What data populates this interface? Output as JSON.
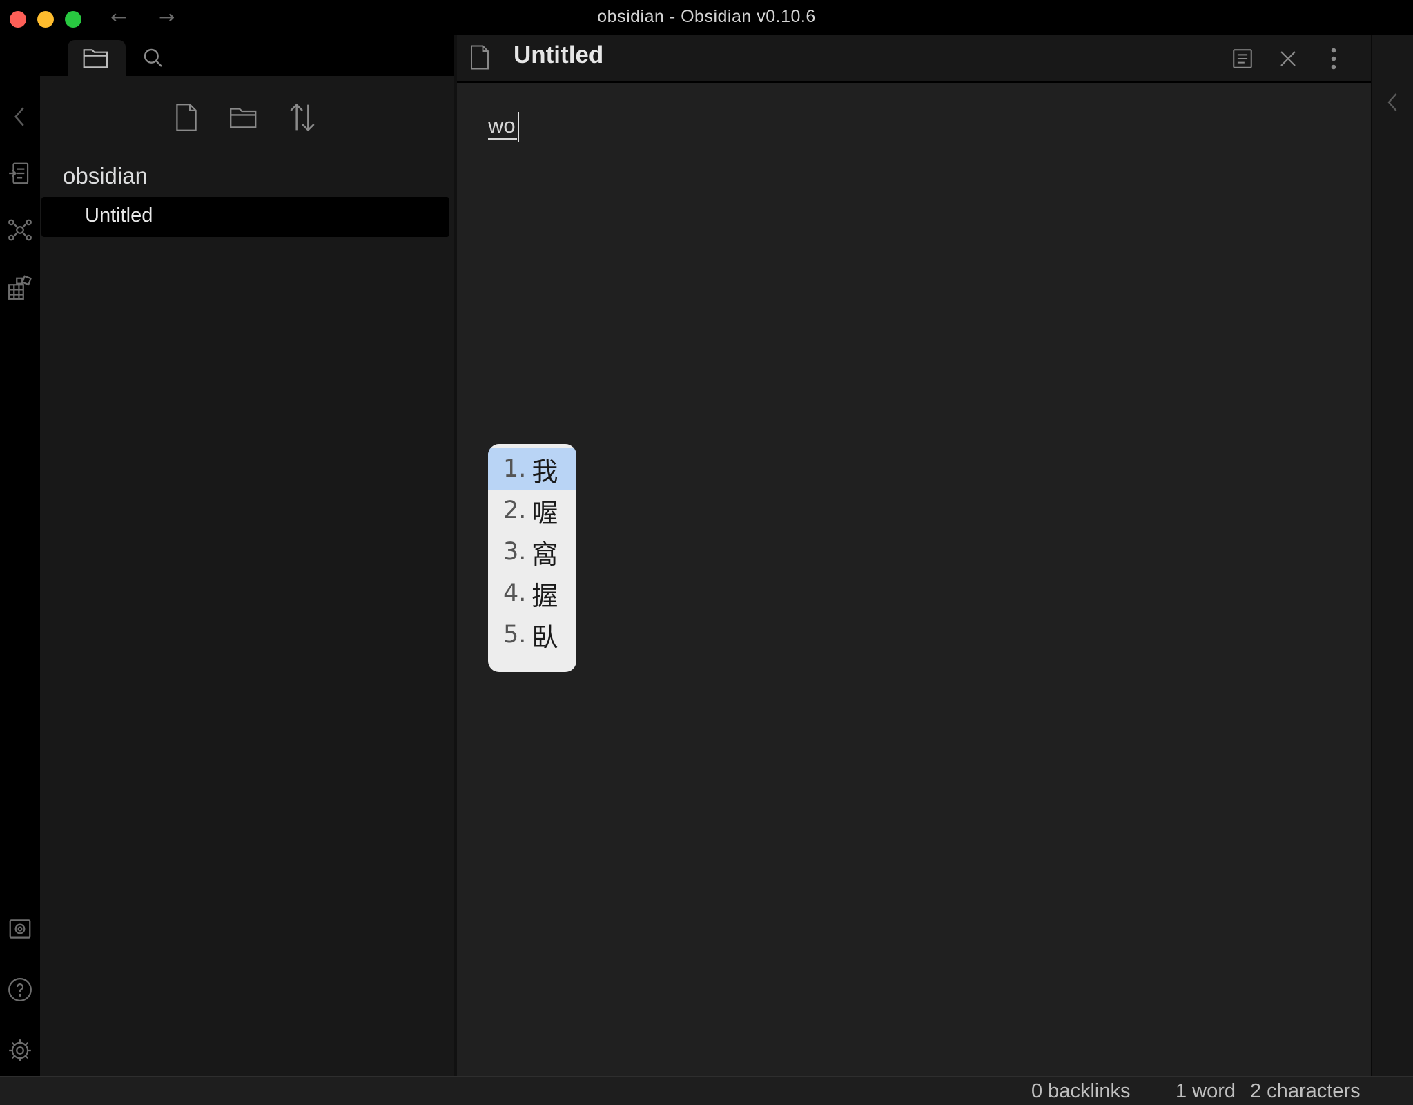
{
  "window": {
    "title": "obsidian - Obsidian v0.10.6",
    "back_arrow": "←",
    "forward_arrow": "→"
  },
  "ribbon": {
    "icons": [
      "collapse-left-icon",
      "open-quick-switcher-icon",
      "graph-view-icon",
      "templates-icon",
      "vault-switch-icon",
      "help-icon",
      "settings-icon"
    ]
  },
  "sidebar": {
    "tabs": [
      "file-explorer-tab",
      "search-tab"
    ],
    "tools": [
      "new-note-icon",
      "new-folder-icon",
      "sort-icon"
    ],
    "vault_name": "obsidian",
    "files": [
      {
        "name": "Untitled",
        "active": true
      }
    ]
  },
  "editor": {
    "title": "Untitled",
    "text": "wo",
    "header_actions": [
      "preview-toggle-icon",
      "close-icon",
      "more-options-icon"
    ]
  },
  "ime_candidates": [
    {
      "num": "1.",
      "char": "我",
      "selected": true
    },
    {
      "num": "2.",
      "char": "喔",
      "selected": false
    },
    {
      "num": "3.",
      "char": "窩",
      "selected": false
    },
    {
      "num": "4.",
      "char": "握",
      "selected": false
    },
    {
      "num": "5.",
      "char": "臥",
      "selected": false
    }
  ],
  "status_bar": {
    "backlinks": "0 backlinks",
    "words": "1 word",
    "characters": "2 characters"
  },
  "colors": {
    "background": "#000000",
    "sidebar": "#181818",
    "editor": "#202020",
    "ime_selected": "#b9d4f5",
    "ime_background": "#ededed"
  }
}
